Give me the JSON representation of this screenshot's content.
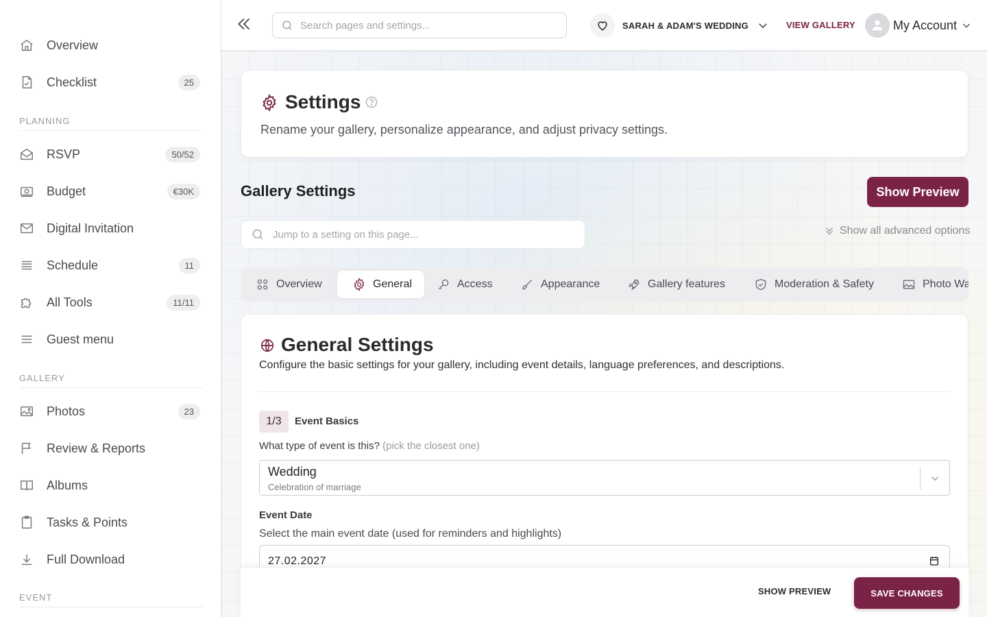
{
  "sidebar": {
    "items_top": [
      {
        "label": "Overview",
        "icon": "home-icon",
        "badge": ""
      },
      {
        "label": "Checklist",
        "icon": "checklist-icon",
        "badge": "25"
      }
    ],
    "sections": [
      {
        "title": "PLANNING",
        "items": [
          {
            "label": "RSVP",
            "icon": "envelope-open-icon",
            "badge": "50/52"
          },
          {
            "label": "Budget",
            "icon": "money-icon",
            "badge": "€30K"
          },
          {
            "label": "Digital Invitation",
            "icon": "mail-icon",
            "badge": ""
          },
          {
            "label": "Schedule",
            "icon": "list-icon",
            "badge": "11"
          },
          {
            "label": "All Tools",
            "icon": "puzzle-icon",
            "badge": "11/11"
          },
          {
            "label": "Guest menu",
            "icon": "menu-icon",
            "badge": ""
          }
        ]
      },
      {
        "title": "GALLERY",
        "items": [
          {
            "label": "Photos",
            "icon": "image-icon",
            "badge": "23"
          },
          {
            "label": "Review & Reports",
            "icon": "flag-icon",
            "badge": ""
          },
          {
            "label": "Albums",
            "icon": "book-icon",
            "badge": ""
          },
          {
            "label": "Tasks & Points",
            "icon": "clipboard-icon",
            "badge": ""
          },
          {
            "label": "Full Download",
            "icon": "download-icon",
            "badge": ""
          }
        ]
      },
      {
        "title": "EVENT",
        "items": []
      }
    ]
  },
  "topbar": {
    "search_placeholder": "Search pages and settings...",
    "wedding_name": "SARAH & ADAM'S WEDDING",
    "view_gallery": "VIEW GALLERY",
    "account_label": "My Account"
  },
  "settings": {
    "title": "Settings",
    "description": "Rename your gallery, personalize appearance, and adjust privacy settings."
  },
  "gallery": {
    "title": "Gallery Settings",
    "show_preview": "Show Preview",
    "jump_placeholder": "Jump to a setting on this page...",
    "advanced_toggle": "Show all advanced options",
    "tabs": [
      {
        "label": "Overview",
        "icon": "grid-icon",
        "active": false
      },
      {
        "label": "General",
        "icon": "gear-icon",
        "active": true
      },
      {
        "label": "Access",
        "icon": "key-icon",
        "active": false
      },
      {
        "label": "Appearance",
        "icon": "brush-icon",
        "active": false
      },
      {
        "label": "Gallery features",
        "icon": "rocket-icon",
        "active": false
      },
      {
        "label": "Moderation & Safety",
        "icon": "shield-icon",
        "active": false
      },
      {
        "label": "Photo Wa",
        "icon": "image-icon",
        "active": false
      }
    ]
  },
  "general": {
    "title": "General Settings",
    "description": "Configure the basic settings for your gallery, including event details, language preferences, and descriptions.",
    "step_badge": "1/3",
    "step_title": "Event Basics",
    "event_type_label": "What type of event is this?",
    "event_type_hint": "(pick the closest one)",
    "event_type_value": "Wedding",
    "event_type_sub": "Celebration of marriage",
    "event_date_label": "Event Date",
    "event_date_desc": "Select the main event date (used for reminders and highlights)",
    "event_date_value": "27.02.2027"
  },
  "footer": {
    "show_preview": "SHOW PREVIEW",
    "save_changes": "SAVE CHANGES"
  },
  "colors": {
    "accent": "#7b2346"
  }
}
